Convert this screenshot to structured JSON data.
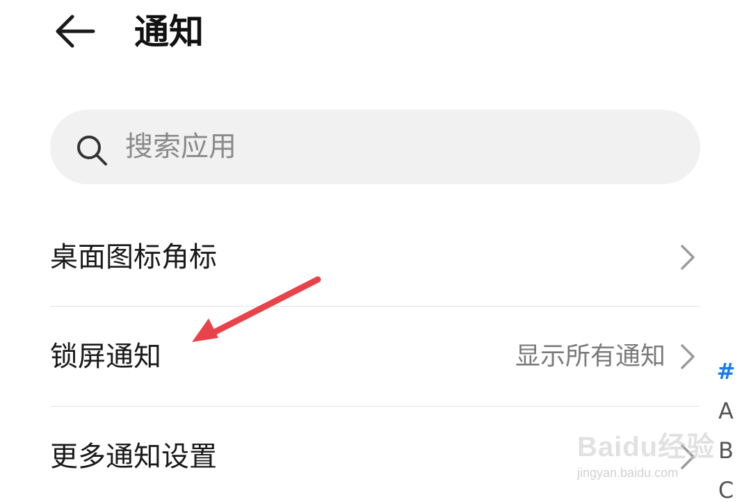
{
  "header": {
    "title": "通知",
    "back_icon": "arrow-left-icon"
  },
  "search": {
    "placeholder": "搜索应用",
    "value": "",
    "icon": "search-icon"
  },
  "list": {
    "items": [
      {
        "label": "桌面图标角标",
        "value": "",
        "chevron_icon": "chevron-right-icon"
      },
      {
        "label": "锁屏通知",
        "value": "显示所有通知",
        "chevron_icon": "chevron-right-icon"
      },
      {
        "label": "更多通知设置",
        "value": "",
        "chevron_icon": "chevron-right-icon"
      }
    ]
  },
  "index": {
    "letters": [
      "#",
      "A",
      "B",
      "C"
    ],
    "active": "#",
    "active_color": "#1a7cf0"
  },
  "annotation": {
    "arrow_color": "#e8434a"
  },
  "watermark": {
    "brand": "Baidu经验",
    "url": "jingyan.baidu.com"
  }
}
